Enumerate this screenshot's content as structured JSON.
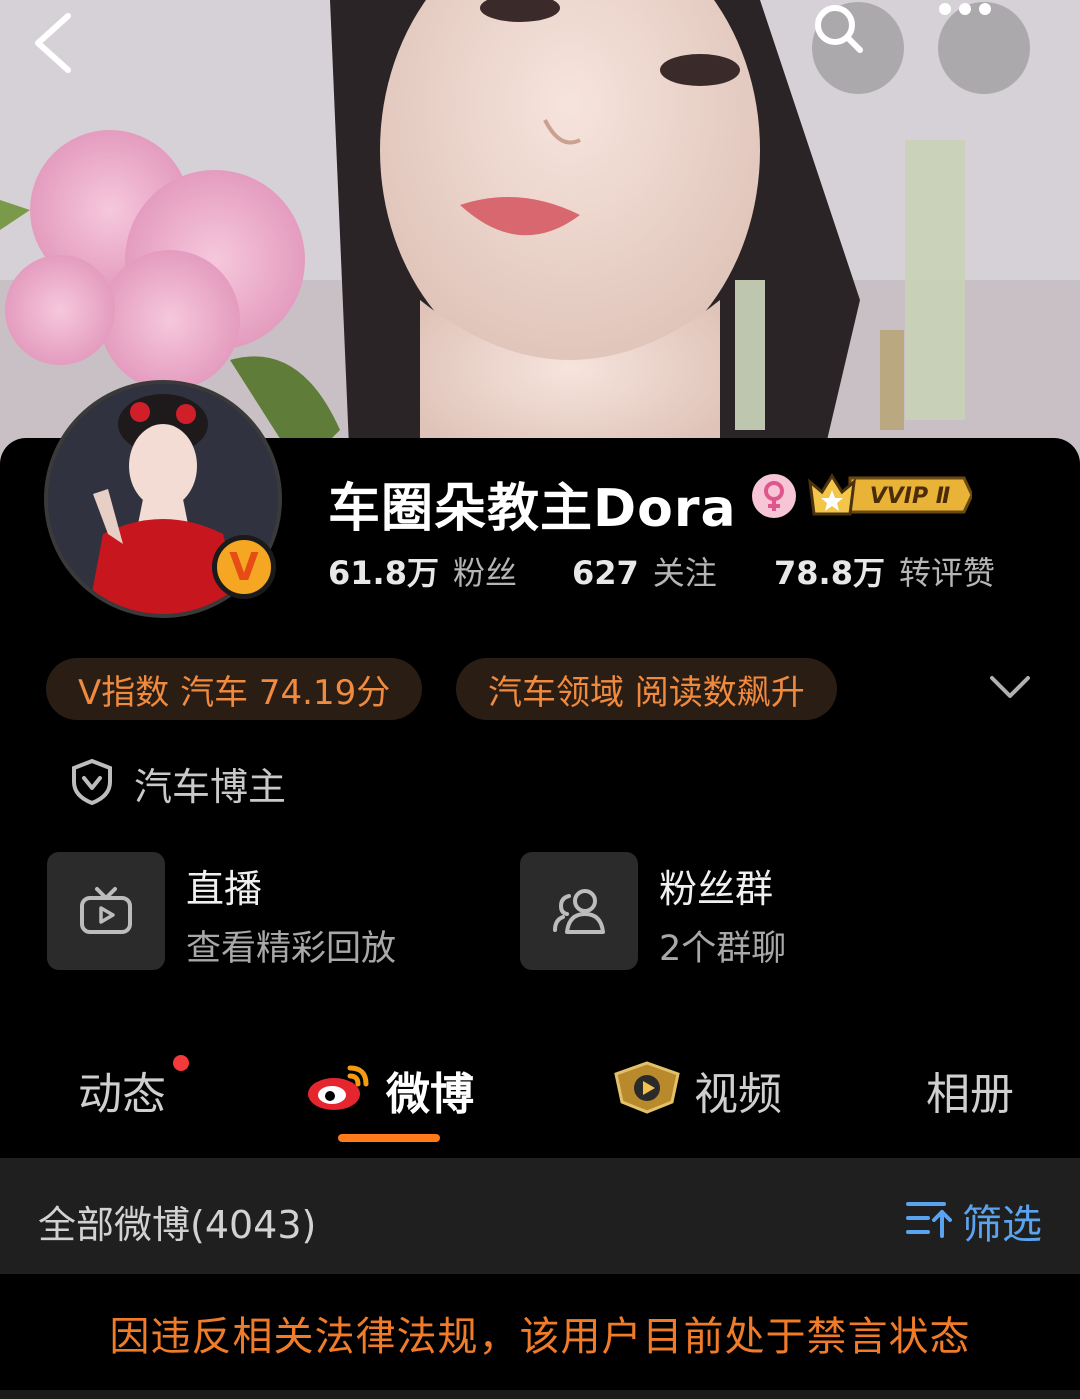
{
  "profile": {
    "name": "车圈朵教主Dora",
    "vvip_label": "VVIP Ⅱ",
    "verify_mark": "V"
  },
  "stats": [
    {
      "num": "61.8万",
      "label": "粉丝"
    },
    {
      "num": "627",
      "label": "关注"
    },
    {
      "num": "78.8万",
      "label": "转评赞"
    }
  ],
  "chips": [
    {
      "text": "V指数 汽车 74.19分"
    },
    {
      "text": "汽车领域 阅读数飙升"
    }
  ],
  "verified": {
    "text": "汽车博主"
  },
  "entries": [
    {
      "title": "直播",
      "subtitle": "查看精彩回放",
      "icon": "tv-icon"
    },
    {
      "title": "粉丝群",
      "subtitle": "2个群聊",
      "icon": "group-icon"
    }
  ],
  "tabs": [
    {
      "label": "动态",
      "has_dot": true
    },
    {
      "label": "微博",
      "active": true
    },
    {
      "label": "视频"
    },
    {
      "label": "相册"
    }
  ],
  "filter": {
    "count_label": "全部微博(4043)",
    "filter_label": "筛选"
  },
  "notice": "因违反相关法律法规，该用户目前处于禁言状态",
  "colors": {
    "accent": "#ff7a1a",
    "chip_text": "#f08a3e",
    "link_blue": "#5aa3ef",
    "notice": "#f07c2a"
  }
}
